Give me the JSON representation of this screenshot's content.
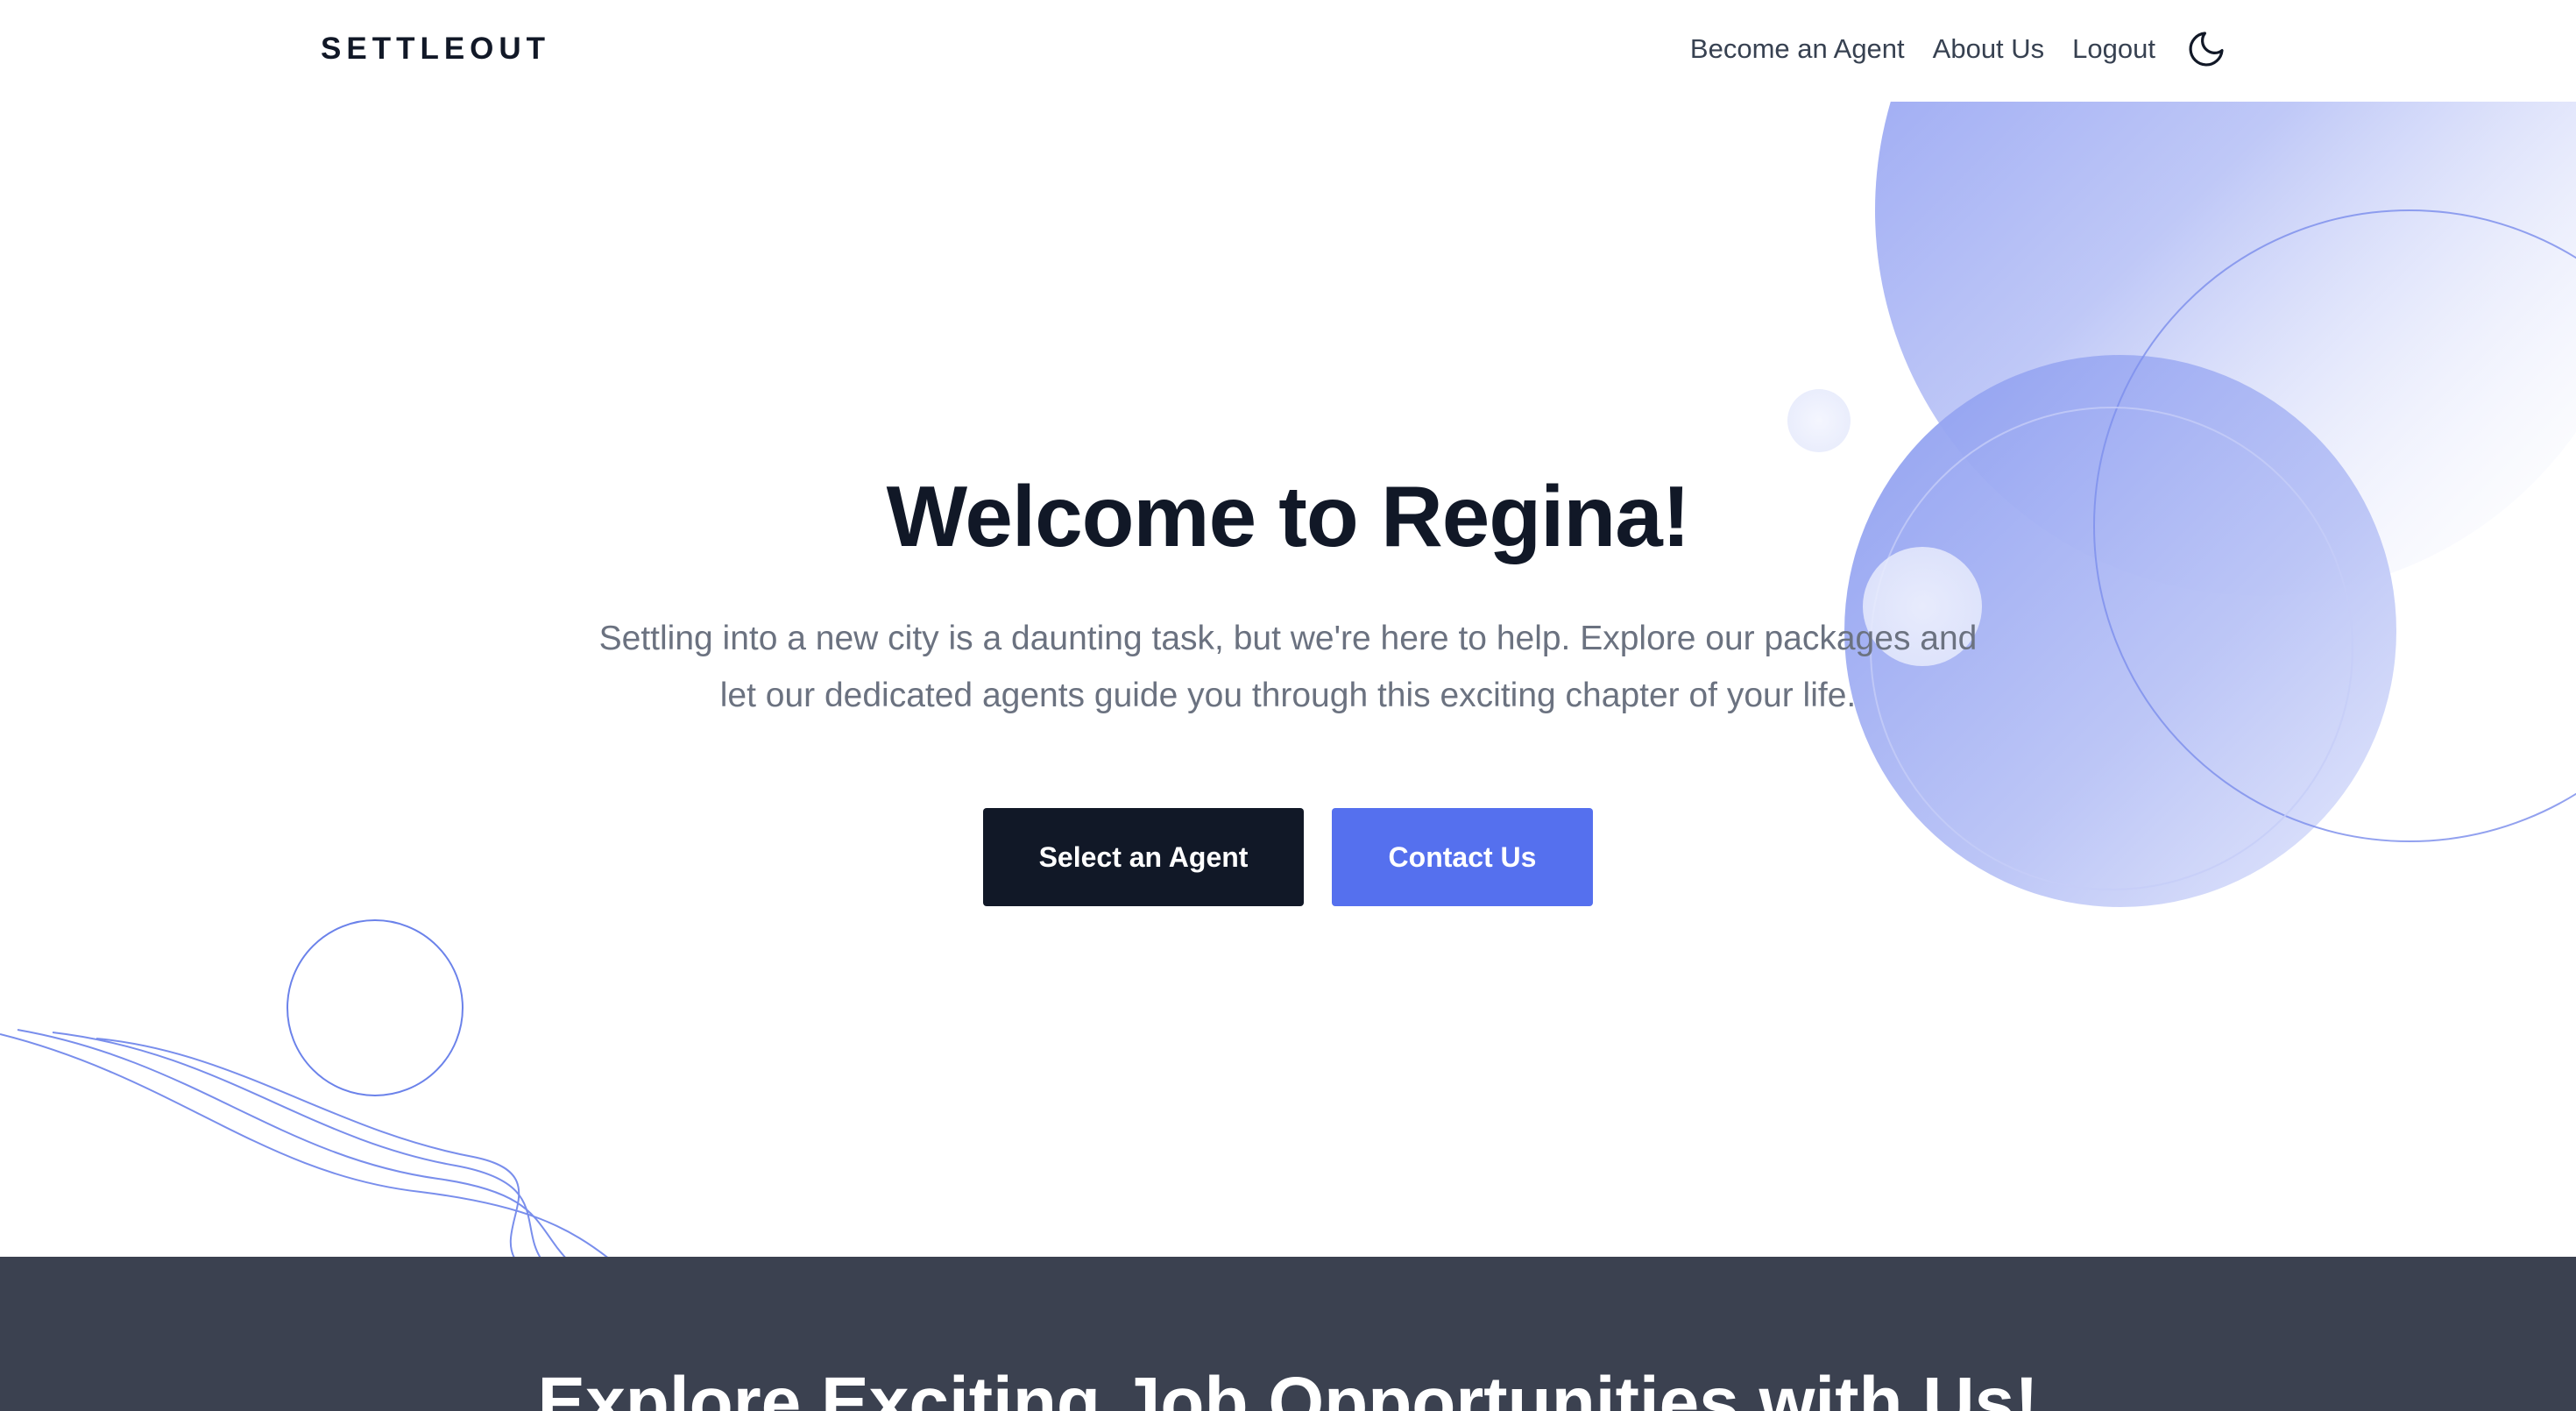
{
  "header": {
    "brand": "SETTLEOUT",
    "nav": {
      "become_agent": "Become an Agent",
      "about_us": "About Us",
      "logout": "Logout"
    },
    "theme_toggle_icon": "moon-icon"
  },
  "hero": {
    "title": "Welcome to Regina!",
    "subtitle": "Settling into a new city is a daunting task, but we're here to help. Explore our packages and let our dedicated agents guide you through this exciting chapter of your life.",
    "buttons": {
      "select_agent": "Select an Agent",
      "contact_us": "Contact Us"
    }
  },
  "jobs": {
    "title": "Explore Exciting Job Opportunities with Us!"
  },
  "colors": {
    "primary": "#5570ee",
    "dark": "#111827",
    "section_bg": "#3b4150",
    "text_muted": "#6b7280"
  }
}
